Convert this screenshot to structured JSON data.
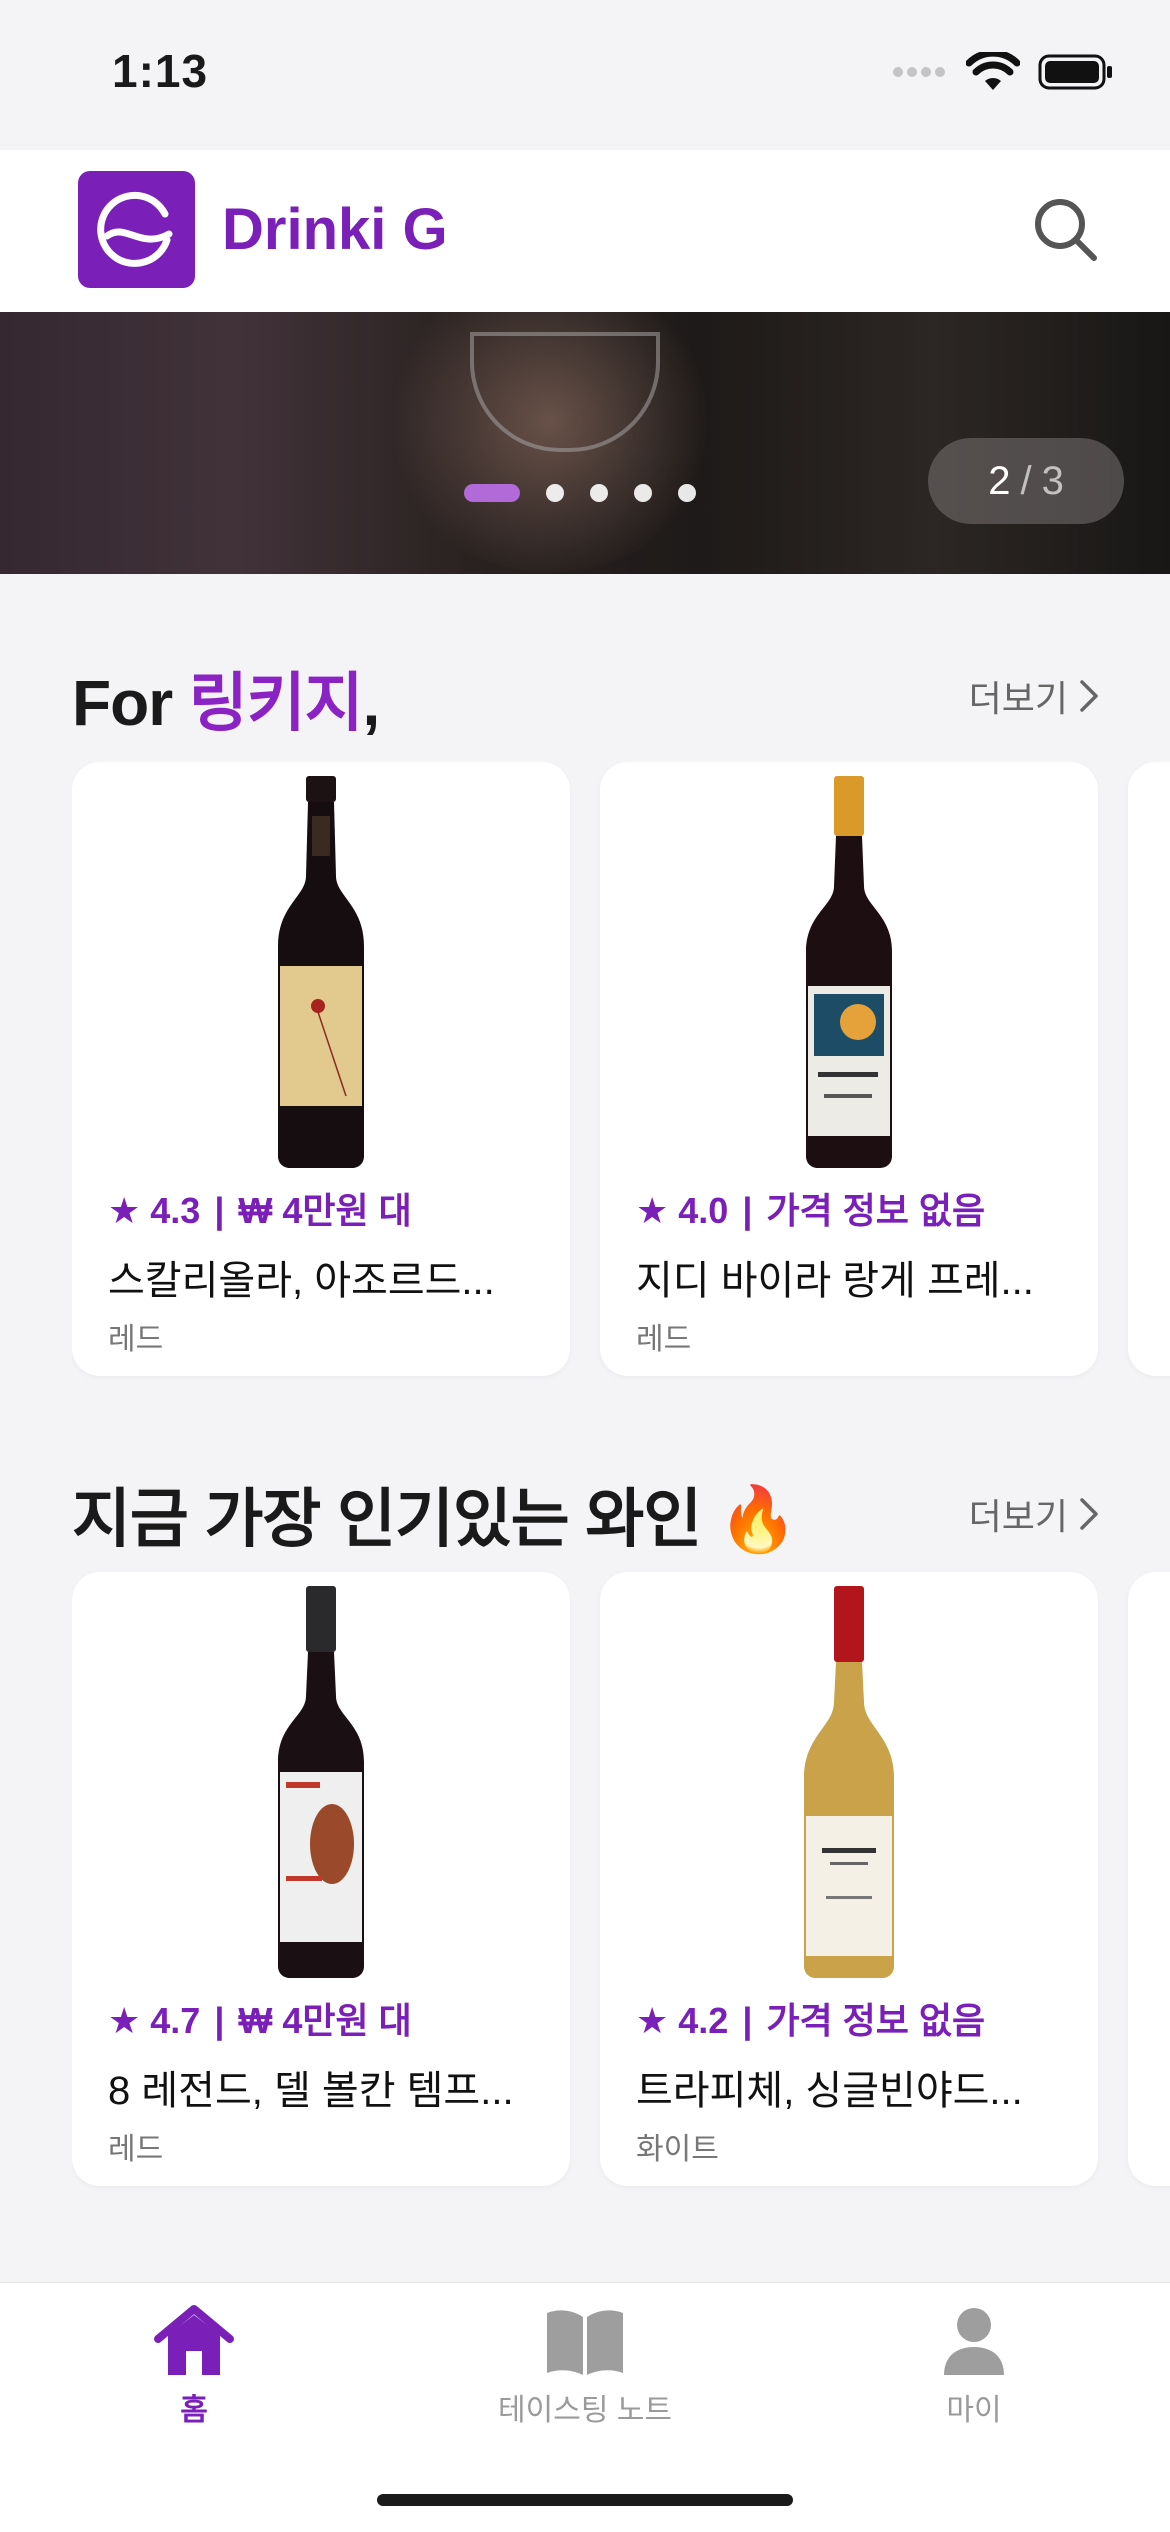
{
  "status_bar": {
    "time": "1:13"
  },
  "header": {
    "app_name": "Drinki G"
  },
  "banner": {
    "current": "2",
    "separator": "/",
    "total": "3",
    "dot_count": 5,
    "active_dot": 1
  },
  "section_recommend": {
    "title_prefix": "For ",
    "title_name": "링키지",
    "title_suffix": ",",
    "more_label": "더보기",
    "cards": [
      {
        "rating": "★ 4.3",
        "separator": "|",
        "price": "₩ 4만원 대",
        "name": "스칼리올라, 아조르드...",
        "type": "레드"
      },
      {
        "rating": "★ 4.0",
        "separator": "|",
        "price": "가격 정보 없음",
        "name": "지디 바이라 랑게 프레...",
        "type": "레드"
      }
    ]
  },
  "section_popular": {
    "title": "지금 가장 인기있는 와인",
    "title_emoji": "🔥",
    "more_label": "더보기",
    "cards": [
      {
        "rating": "★ 4.7",
        "separator": "|",
        "price": "₩ 4만원 대",
        "name": "8 레전드, 델 볼칸 템프...",
        "type": "레드"
      },
      {
        "rating": "★ 4.2",
        "separator": "|",
        "price": "가격 정보 없음",
        "name": "트라피체, 싱글빈야드...",
        "type": "화이트"
      }
    ]
  },
  "tab_bar": {
    "tabs": [
      {
        "label": "홈",
        "icon": "home-icon",
        "active": true
      },
      {
        "label": "테이스팅 노트",
        "icon": "book-icon",
        "active": false
      },
      {
        "label": "마이",
        "icon": "person-icon",
        "active": false
      }
    ]
  },
  "colors": {
    "brand": "#7a1fb8",
    "accent": "#8a22c4",
    "background": "#f4f4f7"
  }
}
